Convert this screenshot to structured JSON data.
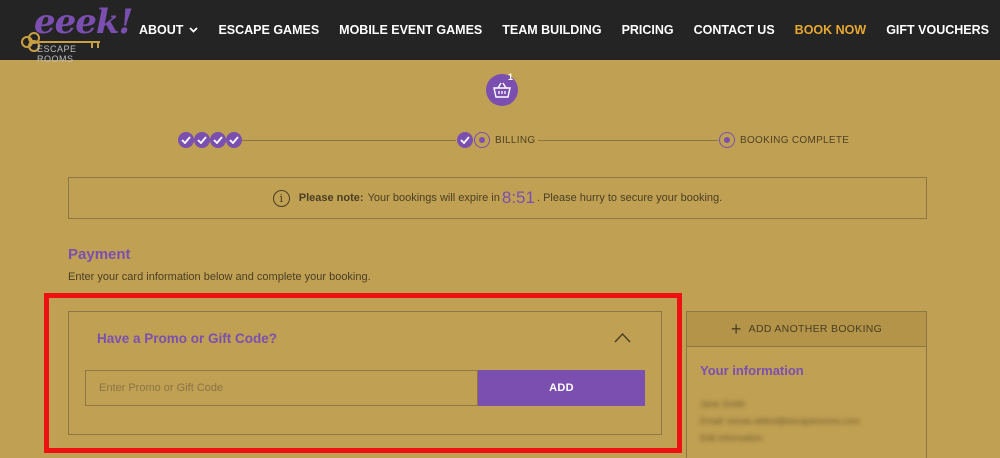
{
  "logo": {
    "word": "eeek!",
    "sub": "ESCAPE ROOMS"
  },
  "nav": {
    "items": [
      {
        "label": "ABOUT",
        "has_dropdown": true
      },
      {
        "label": "ESCAPE GAMES"
      },
      {
        "label": "MOBILE EVENT GAMES"
      },
      {
        "label": "TEAM BUILDING"
      },
      {
        "label": "PRICING"
      },
      {
        "label": "CONTACT US"
      },
      {
        "label": "BOOK NOW",
        "active": true
      },
      {
        "label": "GIFT VOUCHERS"
      }
    ]
  },
  "basket": {
    "count": "1",
    "icon": "basket-icon"
  },
  "progress": {
    "completed_steps": 4,
    "billing_label": "BILLING",
    "complete_label": "BOOKING COMPLETE"
  },
  "notice": {
    "prefix": "Please note:",
    "text_before": "Your bookings will expire in",
    "timer": "8:51",
    "text_after": ". Please hurry to secure your booking."
  },
  "payment": {
    "title": "Payment",
    "description": "Enter your card information below and complete your booking."
  },
  "promo": {
    "title": "Have a Promo or Gift Code?",
    "placeholder": "Enter Promo or Gift Code",
    "add_label": "ADD"
  },
  "sidebar": {
    "add_booking_label": "ADD ANOTHER BOOKING",
    "info_title": "Your information",
    "info_lines": [
      "Jane Smith",
      "Email: tomas.abbot@escaperooms.com",
      "Edit information"
    ]
  },
  "colors": {
    "background": "#c0a052",
    "header": "#242424",
    "accent": "#7b4fb0",
    "active_nav": "#e8a72e",
    "highlight": "#ee1111"
  }
}
